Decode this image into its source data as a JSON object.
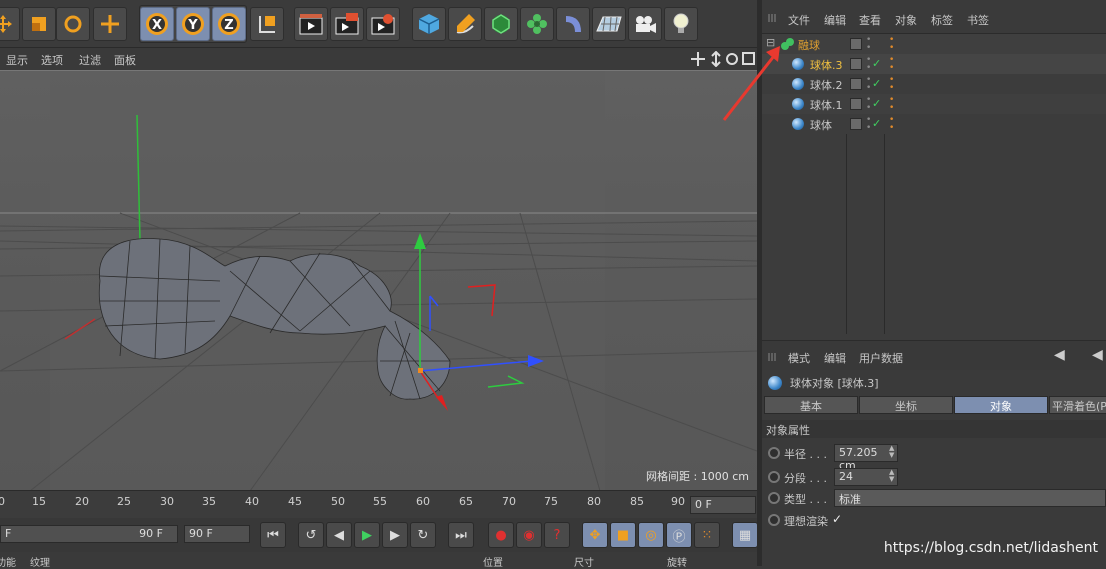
{
  "viewport_menu": [
    "显示",
    "选项",
    "过滤",
    "面板"
  ],
  "viewport": {
    "grid_spacing": "网格间距 : 1000 cm"
  },
  "timeline": {
    "ticks": [
      "0",
      "15",
      "20",
      "25",
      "30",
      "35",
      "40",
      "45",
      "50",
      "55",
      "60",
      "65",
      "70",
      "75",
      "80",
      "85",
      "90"
    ],
    "current_frame": "0 F"
  },
  "controls": {
    "start_field": "F",
    "end_field_left": "90 F",
    "end_field_right": "90 F"
  },
  "bottom_tabs": [
    "功能",
    "纹理",
    "位置",
    "尺寸",
    "旋转"
  ],
  "object_manager": {
    "menu": [
      "文件",
      "编辑",
      "查看",
      "对象",
      "标签",
      "书签"
    ],
    "objects": [
      {
        "name": "融球",
        "color": "#e0a030"
      },
      {
        "name": "球体.3",
        "color": "#f0c040"
      },
      {
        "name": "球体.2",
        "color": "#c8c8c8"
      },
      {
        "name": "球体.1",
        "color": "#c8c8c8"
      },
      {
        "name": "球体",
        "color": "#c8c8c8"
      }
    ]
  },
  "attributes": {
    "menu": [
      "模式",
      "编辑",
      "用户数据"
    ],
    "title": "球体对象 [球体.3]",
    "tabs": [
      "基本",
      "坐标",
      "对象",
      "平滑着色(P"
    ],
    "section": "对象属性",
    "props": [
      {
        "label": "半径 . . .",
        "value": "57.205 cm"
      },
      {
        "label": "分段 . . .",
        "value": "24"
      },
      {
        "label": "类型 . . .",
        "value": "标准"
      },
      {
        "label": "理想渲染",
        "value": "✓"
      }
    ]
  },
  "watermark": "https://blog.csdn.net/lidashent",
  "colors": {
    "accent": "#7d8fb0",
    "selected_text": "#f0c040",
    "arrow": "#e8392f"
  }
}
